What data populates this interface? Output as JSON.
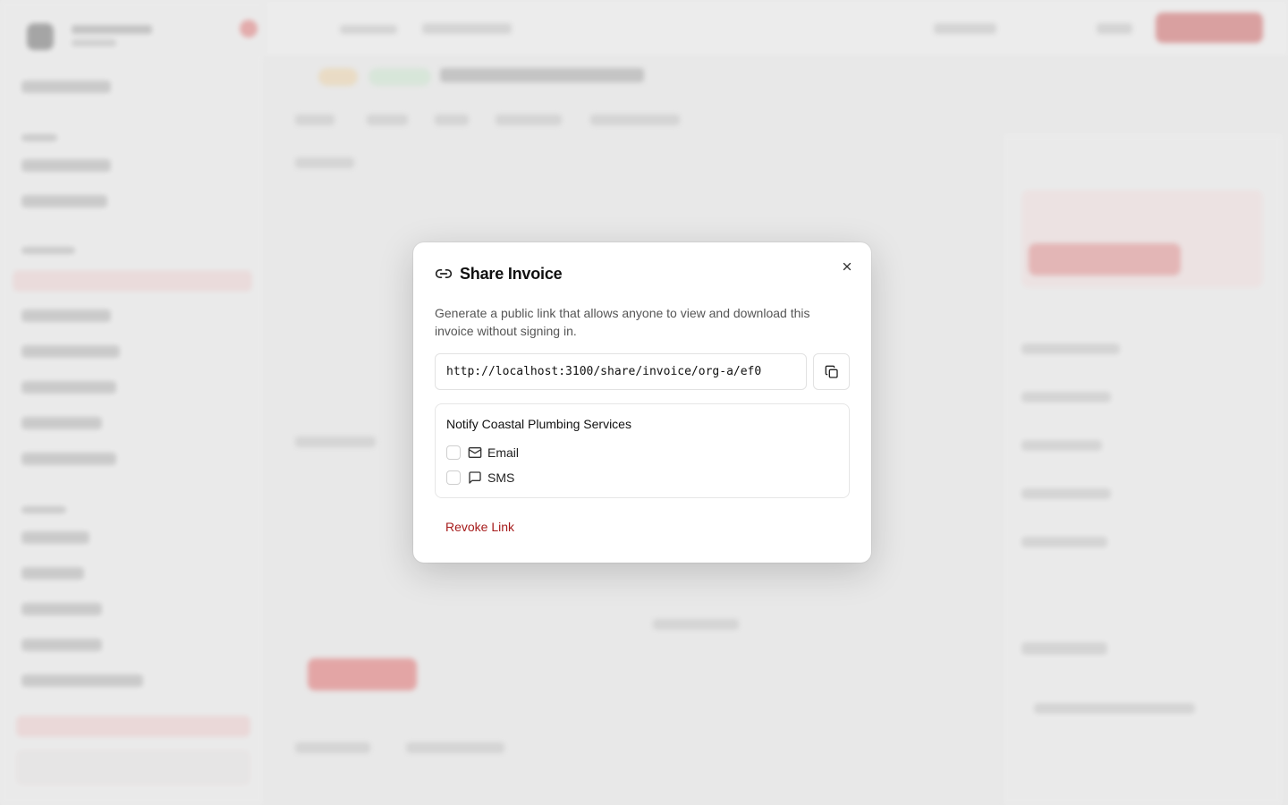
{
  "modal": {
    "title": "Share Invoice",
    "description": "Generate a public link that allows anyone to view and download this invoice without signing in.",
    "share_url": "http://localhost:3100/share/invoice/org-a/ef0",
    "notify": {
      "title": "Notify Coastal Plumbing Services",
      "options": [
        {
          "label": "Email",
          "icon": "mail-icon",
          "checked": false
        },
        {
          "label": "SMS",
          "icon": "message-icon",
          "checked": false
        }
      ]
    },
    "revoke_label": "Revoke Link"
  },
  "colors": {
    "accent": "#c42424",
    "revoke_text": "#a61b1b"
  }
}
